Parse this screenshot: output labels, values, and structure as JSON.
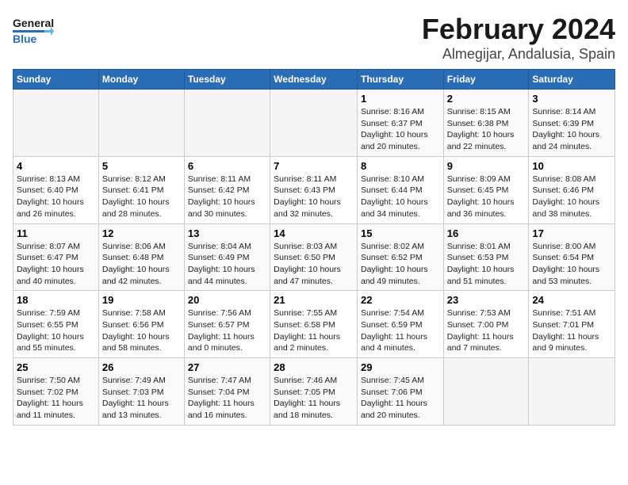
{
  "header": {
    "logo_general": "General",
    "logo_blue": "Blue",
    "month": "February 2024",
    "location": "Almegijar, Andalusia, Spain"
  },
  "weekdays": [
    "Sunday",
    "Monday",
    "Tuesday",
    "Wednesday",
    "Thursday",
    "Friday",
    "Saturday"
  ],
  "weeks": [
    [
      {
        "day": "",
        "info": ""
      },
      {
        "day": "",
        "info": ""
      },
      {
        "day": "",
        "info": ""
      },
      {
        "day": "",
        "info": ""
      },
      {
        "day": "1",
        "info": "Sunrise: 8:16 AM\nSunset: 6:37 PM\nDaylight: 10 hours\nand 20 minutes."
      },
      {
        "day": "2",
        "info": "Sunrise: 8:15 AM\nSunset: 6:38 PM\nDaylight: 10 hours\nand 22 minutes."
      },
      {
        "day": "3",
        "info": "Sunrise: 8:14 AM\nSunset: 6:39 PM\nDaylight: 10 hours\nand 24 minutes."
      }
    ],
    [
      {
        "day": "4",
        "info": "Sunrise: 8:13 AM\nSunset: 6:40 PM\nDaylight: 10 hours\nand 26 minutes."
      },
      {
        "day": "5",
        "info": "Sunrise: 8:12 AM\nSunset: 6:41 PM\nDaylight: 10 hours\nand 28 minutes."
      },
      {
        "day": "6",
        "info": "Sunrise: 8:11 AM\nSunset: 6:42 PM\nDaylight: 10 hours\nand 30 minutes."
      },
      {
        "day": "7",
        "info": "Sunrise: 8:11 AM\nSunset: 6:43 PM\nDaylight: 10 hours\nand 32 minutes."
      },
      {
        "day": "8",
        "info": "Sunrise: 8:10 AM\nSunset: 6:44 PM\nDaylight: 10 hours\nand 34 minutes."
      },
      {
        "day": "9",
        "info": "Sunrise: 8:09 AM\nSunset: 6:45 PM\nDaylight: 10 hours\nand 36 minutes."
      },
      {
        "day": "10",
        "info": "Sunrise: 8:08 AM\nSunset: 6:46 PM\nDaylight: 10 hours\nand 38 minutes."
      }
    ],
    [
      {
        "day": "11",
        "info": "Sunrise: 8:07 AM\nSunset: 6:47 PM\nDaylight: 10 hours\nand 40 minutes."
      },
      {
        "day": "12",
        "info": "Sunrise: 8:06 AM\nSunset: 6:48 PM\nDaylight: 10 hours\nand 42 minutes."
      },
      {
        "day": "13",
        "info": "Sunrise: 8:04 AM\nSunset: 6:49 PM\nDaylight: 10 hours\nand 44 minutes."
      },
      {
        "day": "14",
        "info": "Sunrise: 8:03 AM\nSunset: 6:50 PM\nDaylight: 10 hours\nand 47 minutes."
      },
      {
        "day": "15",
        "info": "Sunrise: 8:02 AM\nSunset: 6:52 PM\nDaylight: 10 hours\nand 49 minutes."
      },
      {
        "day": "16",
        "info": "Sunrise: 8:01 AM\nSunset: 6:53 PM\nDaylight: 10 hours\nand 51 minutes."
      },
      {
        "day": "17",
        "info": "Sunrise: 8:00 AM\nSunset: 6:54 PM\nDaylight: 10 hours\nand 53 minutes."
      }
    ],
    [
      {
        "day": "18",
        "info": "Sunrise: 7:59 AM\nSunset: 6:55 PM\nDaylight: 10 hours\nand 55 minutes."
      },
      {
        "day": "19",
        "info": "Sunrise: 7:58 AM\nSunset: 6:56 PM\nDaylight: 10 hours\nand 58 minutes."
      },
      {
        "day": "20",
        "info": "Sunrise: 7:56 AM\nSunset: 6:57 PM\nDaylight: 11 hours\nand 0 minutes."
      },
      {
        "day": "21",
        "info": "Sunrise: 7:55 AM\nSunset: 6:58 PM\nDaylight: 11 hours\nand 2 minutes."
      },
      {
        "day": "22",
        "info": "Sunrise: 7:54 AM\nSunset: 6:59 PM\nDaylight: 11 hours\nand 4 minutes."
      },
      {
        "day": "23",
        "info": "Sunrise: 7:53 AM\nSunset: 7:00 PM\nDaylight: 11 hours\nand 7 minutes."
      },
      {
        "day": "24",
        "info": "Sunrise: 7:51 AM\nSunset: 7:01 PM\nDaylight: 11 hours\nand 9 minutes."
      }
    ],
    [
      {
        "day": "25",
        "info": "Sunrise: 7:50 AM\nSunset: 7:02 PM\nDaylight: 11 hours\nand 11 minutes."
      },
      {
        "day": "26",
        "info": "Sunrise: 7:49 AM\nSunset: 7:03 PM\nDaylight: 11 hours\nand 13 minutes."
      },
      {
        "day": "27",
        "info": "Sunrise: 7:47 AM\nSunset: 7:04 PM\nDaylight: 11 hours\nand 16 minutes."
      },
      {
        "day": "28",
        "info": "Sunrise: 7:46 AM\nSunset: 7:05 PM\nDaylight: 11 hours\nand 18 minutes."
      },
      {
        "day": "29",
        "info": "Sunrise: 7:45 AM\nSunset: 7:06 PM\nDaylight: 11 hours\nand 20 minutes."
      },
      {
        "day": "",
        "info": ""
      },
      {
        "day": "",
        "info": ""
      }
    ]
  ]
}
